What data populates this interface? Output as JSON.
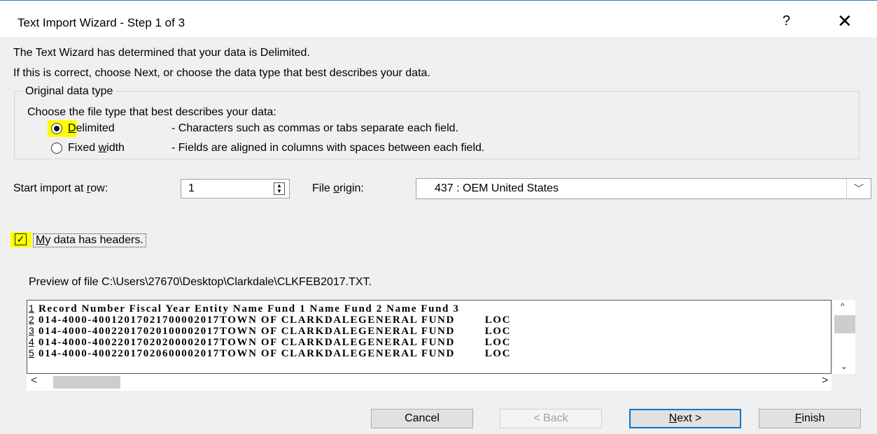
{
  "window": {
    "title": "Text Import Wizard - Step 1 of 3",
    "help_label": "?",
    "close_label": "✕"
  },
  "intro": {
    "line1": "The Text Wizard has determined that your data is Delimited.",
    "line2": "If this is correct, choose Next, or choose the data type that best describes your data."
  },
  "original_data_type": {
    "legend": "Original data type",
    "prompt": "Choose the file type that best describes your data:",
    "options": [
      {
        "label_underlined": "D",
        "label_rest": "elimited",
        "description": "- Characters such as commas or tabs separate each field.",
        "selected": true
      },
      {
        "label_prefix": "Fixed ",
        "label_underlined": "w",
        "label_rest": "idth",
        "description": "- Fields are aligned in columns with spaces between each field.",
        "selected": false
      }
    ]
  },
  "start_import": {
    "label_prefix": "Start import at ",
    "label_underlined": "r",
    "label_rest": "ow:",
    "value": "1"
  },
  "file_origin": {
    "label_prefix": "File ",
    "label_underlined": "o",
    "label_rest": "rigin:",
    "value": "437 : OEM United States"
  },
  "headers_checkbox": {
    "label_underlined": "M",
    "label_rest": "y data has headers.",
    "checked": true
  },
  "preview": {
    "label": "Preview of file C:\\Users\\27670\\Desktop\\Clarkdale\\CLKFEB2017.TXT.",
    "rows": [
      {
        "num": "1",
        "text": "Record Number Fiscal Year Entity Name Fund 1 Name Fund 2 Name Fund 3"
      },
      {
        "num": "2",
        "text": "014-4000-40012017021700002017TOWN OF CLARKDALEGENERAL FUND        LOC"
      },
      {
        "num": "3",
        "text": "014-4000-40022017020100002017TOWN OF CLARKDALEGENERAL FUND        LOC"
      },
      {
        "num": "4",
        "text": "014-4000-40022017020200002017TOWN OF CLARKDALEGENERAL FUND        LOC"
      },
      {
        "num": "5",
        "text": "014-4000-40022017020600002017TOWN OF CLARKDALEGENERAL FUND        LOC"
      }
    ]
  },
  "scroll": {
    "up": "^",
    "down": "⌄",
    "left": "<",
    "right": ">"
  },
  "buttons": {
    "cancel": "Cancel",
    "back": "< Back",
    "next_underlined": "N",
    "next_rest": "ext >",
    "finish_underlined": "F",
    "finish_rest": "inish"
  },
  "colors": {
    "highlight": "#ffff00",
    "accent": "#0078d7"
  }
}
